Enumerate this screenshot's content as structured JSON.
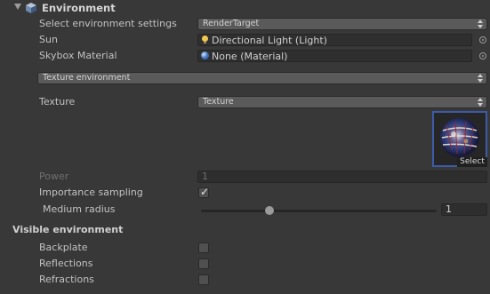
{
  "header": {
    "title": "Environment"
  },
  "settings": {
    "select_env_label": "Select environment settings",
    "select_env_value": "RenderTarget",
    "sun_label": "Sun",
    "sun_value": "Directional Light (Light)",
    "skybox_label": "Skybox Material",
    "skybox_value": "None (Material)"
  },
  "env_mode": {
    "value": "Texture environment"
  },
  "texture": {
    "label": "Texture",
    "dropdown_value": "Texture",
    "select_label": "Select"
  },
  "power": {
    "label": "Power",
    "value": "1"
  },
  "importance_sampling": {
    "label": "Importance sampling",
    "checked": true
  },
  "medium_radius": {
    "label": "Medium radius",
    "value": "1",
    "slider_fraction": 0.29
  },
  "visible_environment": {
    "title": "Visible environment",
    "backplate_label": "Backplate",
    "reflections_label": "Reflections",
    "refractions_label": "Refractions"
  },
  "icons": {
    "foldout": "foldout-arrow-icon",
    "header": "environment-cube-icon",
    "sun": "light-bulb-icon",
    "skybox": "material-sphere-icon",
    "picker": "object-picker-icon",
    "dropdown": "dropdown-arrows-icon",
    "check": "checkmark-icon"
  },
  "colors": {
    "background": "#383838",
    "selection_border": "#3c5aa8"
  }
}
